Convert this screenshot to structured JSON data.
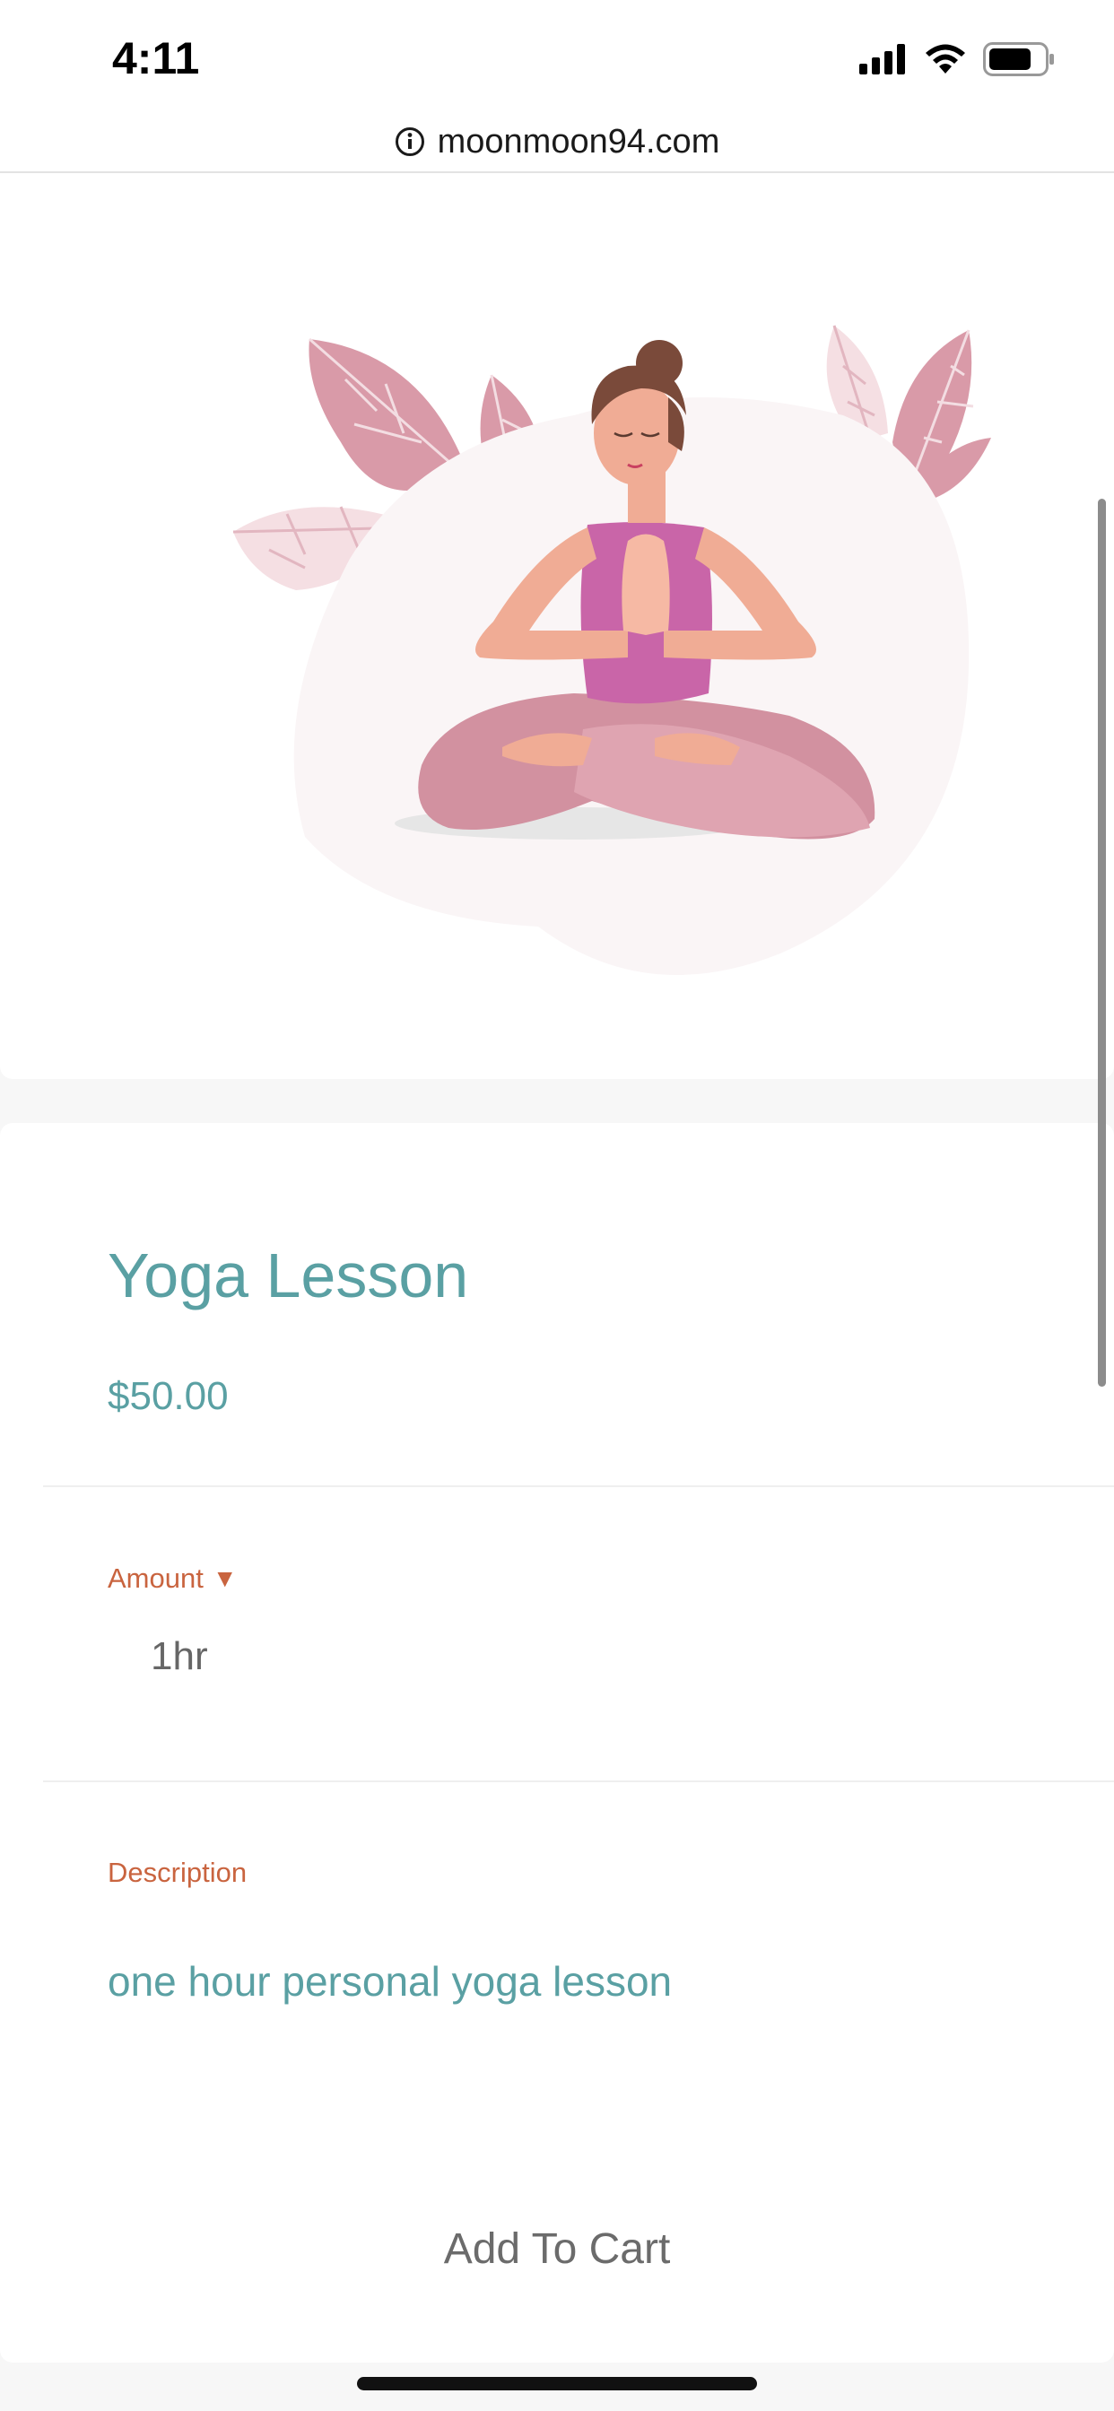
{
  "status_bar": {
    "time": "4:11",
    "icons": [
      "cellular-signal-icon",
      "wifi-icon",
      "battery-icon"
    ]
  },
  "browser": {
    "url": "moonmoon94.com",
    "info_icon": "info-icon"
  },
  "hero": {
    "illustration": "woman-meditating-yoga-illustration"
  },
  "product": {
    "title": "Yoga Lesson",
    "price": "$50.00",
    "amount": {
      "label": "Amount",
      "arrow": "▼",
      "selected": "1hr"
    },
    "description": {
      "label": "Description",
      "text": "one hour personal yoga lesson"
    },
    "add_to_cart_label": "Add To Cart"
  },
  "colors": {
    "accent_teal": "#5aa0a3",
    "label_orange": "#c9643f",
    "leaf_pink": "#d99aa8",
    "shirt_magenta": "#c965a8"
  }
}
